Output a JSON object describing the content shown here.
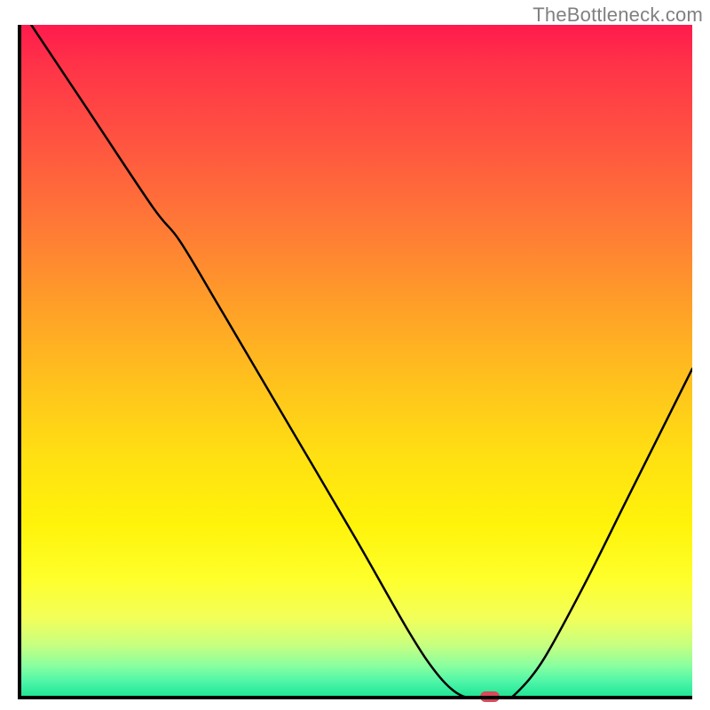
{
  "watermark": "TheBottleneck.com",
  "chart_data": {
    "type": "line",
    "title": "",
    "xlabel": "",
    "ylabel": "",
    "xlim": [
      0,
      100
    ],
    "ylim": [
      0,
      100
    ],
    "grid": false,
    "legend": false,
    "curve": [
      {
        "x": 2,
        "y": 100
      },
      {
        "x": 10,
        "y": 88
      },
      {
        "x": 20,
        "y": 73
      },
      {
        "x": 24,
        "y": 68
      },
      {
        "x": 30,
        "y": 58
      },
      {
        "x": 40,
        "y": 41
      },
      {
        "x": 50,
        "y": 24
      },
      {
        "x": 58,
        "y": 10
      },
      {
        "x": 62,
        "y": 4
      },
      {
        "x": 65,
        "y": 1
      },
      {
        "x": 68,
        "y": 0
      },
      {
        "x": 72,
        "y": 0
      },
      {
        "x": 74,
        "y": 1
      },
      {
        "x": 78,
        "y": 6
      },
      {
        "x": 84,
        "y": 17
      },
      {
        "x": 90,
        "y": 29
      },
      {
        "x": 96,
        "y": 41
      },
      {
        "x": 100,
        "y": 49
      }
    ],
    "marker": {
      "x": 70,
      "y": 0.4,
      "color": "#d84a5a"
    }
  }
}
